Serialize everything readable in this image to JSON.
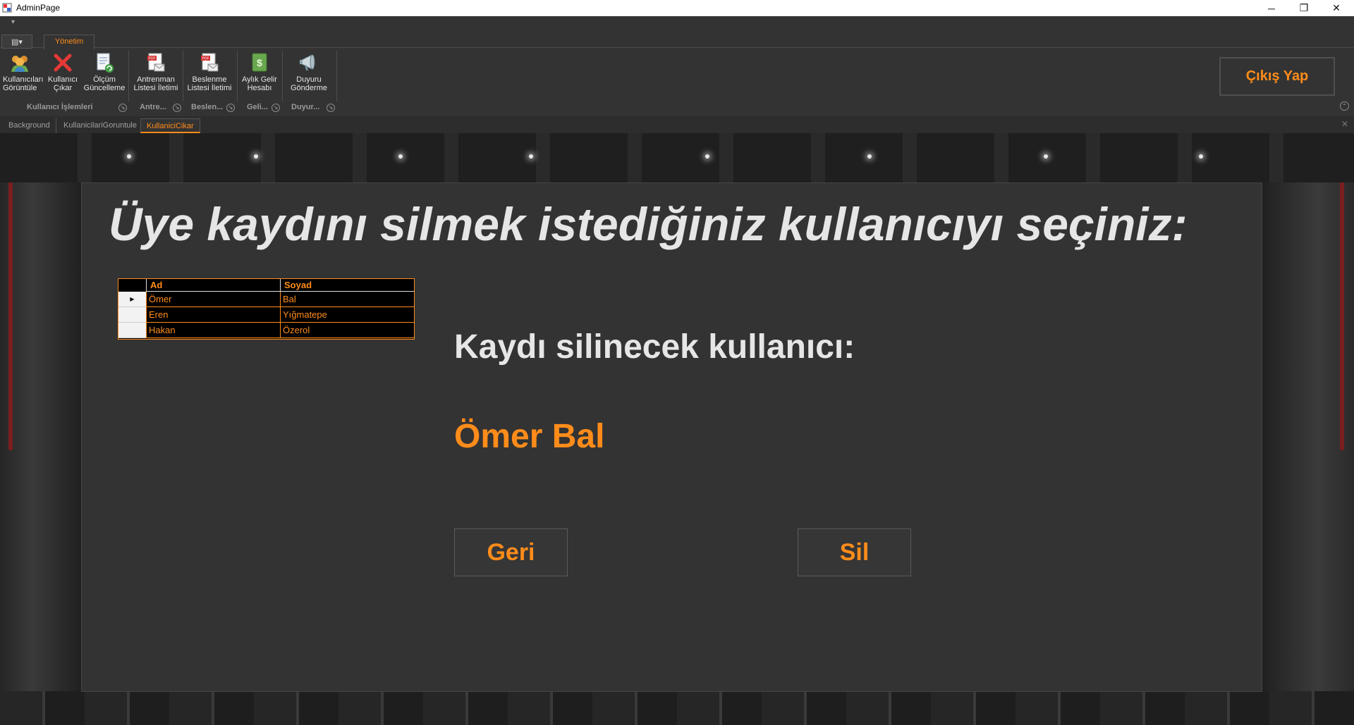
{
  "window": {
    "title": "AdminPage",
    "minimize_icon": "─",
    "restore_icon": "❐",
    "close_icon": "✕"
  },
  "ribbon": {
    "qat_symbol": "▾",
    "app_menu_icon": "▤▾",
    "tab_label": "Yönetim",
    "buttons": [
      {
        "label": "Kullanıcıları Görüntüle",
        "icon": "users-icon"
      },
      {
        "label": "Kullanıcı Çıkar",
        "icon": "red-x-icon"
      },
      {
        "label": "Ölçüm Güncelleme",
        "icon": "document-refresh-icon"
      },
      {
        "label": "Antrenman Listesi İletimi",
        "icon": "pdf-mail-icon"
      },
      {
        "label": "Beslenme Listesi İletimi",
        "icon": "pdf-mail-icon"
      },
      {
        "label": "Aylık Gelir Hesabı",
        "icon": "money-book-icon"
      },
      {
        "label": "Duyuru Gönderme",
        "icon": "megaphone-icon"
      }
    ],
    "groups": [
      {
        "label": "Kullanıcı İşlemleri"
      },
      {
        "label": "Antre..."
      },
      {
        "label": "Beslen..."
      },
      {
        "label": "Geli..."
      },
      {
        "label": "Duyur..."
      }
    ],
    "launcher_symbol": "↘",
    "collapse_symbol": "⌃",
    "logout_label": "Çıkış Yap"
  },
  "doc_tabs": [
    {
      "label": "Background"
    },
    {
      "label": "KullanicilariGoruntule"
    },
    {
      "label": "KullaniciCikar",
      "active": true
    }
  ],
  "doc_close": "✕",
  "panel": {
    "heading": "Üye kaydını silmek istediğiniz kullanıcıyı seçiniz:",
    "grid": {
      "columns": [
        "Ad",
        "Soyad"
      ],
      "current_row_marker": "▶",
      "rows": [
        {
          "ad": "Ömer",
          "soyad": "Bal"
        },
        {
          "ad": "Eren",
          "soyad": "Yığmatepe"
        },
        {
          "ad": "Hakan",
          "soyad": "Özerol"
        }
      ]
    },
    "label": "Kaydı silinecek kullanıcı:",
    "selected_user": "Ömer Bal",
    "back_label": "Geri",
    "delete_label": "Sil"
  },
  "colors": {
    "accent": "#ff8c1a",
    "panel": "#333333",
    "text": "#e6e6e6"
  }
}
